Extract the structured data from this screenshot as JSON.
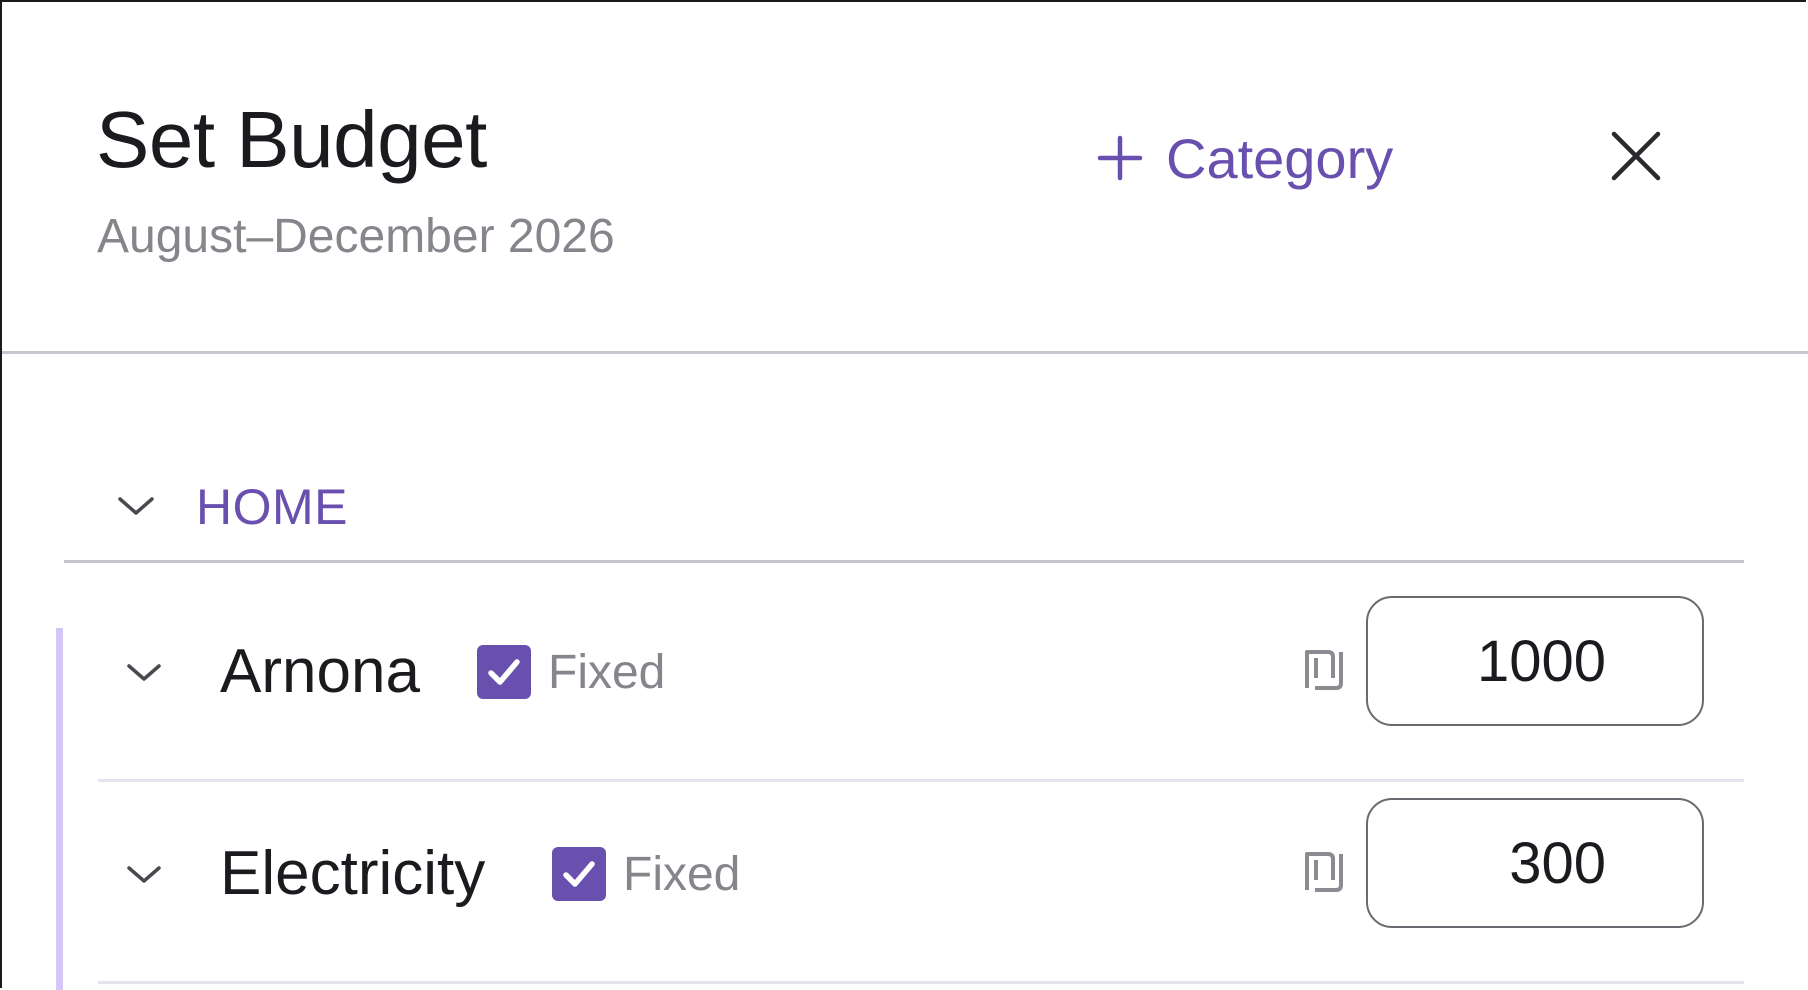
{
  "header": {
    "title": "Set Budget",
    "subtitle": "August–December 2026",
    "add_category_label": "Category",
    "add_icon": "plus-icon",
    "close_icon": "close-icon"
  },
  "group": {
    "name": "HOME",
    "expanded": true,
    "chevron_icon": "chevron-down-icon"
  },
  "categories": [
    {
      "name": "Arnona",
      "fixed_checked": true,
      "fixed_label": "Fixed",
      "currency_symbol": "₪",
      "amount": "1000"
    },
    {
      "name": "Electricity",
      "fixed_checked": true,
      "fixed_label": "Fixed",
      "currency_symbol": "₪",
      "amount": "300"
    }
  ],
  "colors": {
    "accent": "#6a50ae",
    "accent_light": "#d4c6f6",
    "text": "#1b1b1f",
    "muted": "#86858c",
    "divider": "#c8c5d0"
  }
}
